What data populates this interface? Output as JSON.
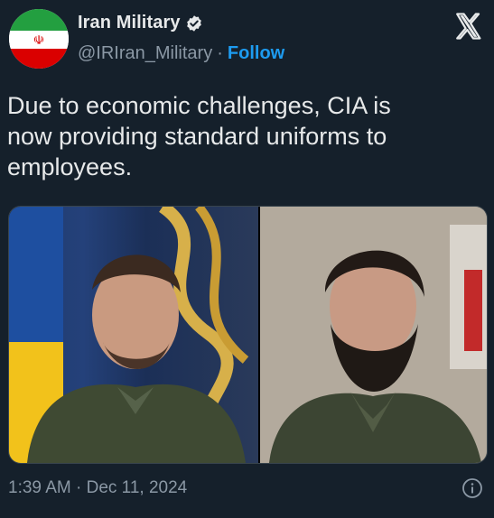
{
  "author": {
    "display_name": "Iran Military",
    "handle": "@IRIran_Military",
    "follow_label": "Follow",
    "separator": "·",
    "verified": true,
    "avatar_icon": "iran-flag-icon"
  },
  "tweet": {
    "text": "Due to economic challenges, CIA is\nnow providing standard uniforms to\nemployees.",
    "media": [
      {
        "kind": "photo",
        "description_icon": "photo-icon"
      },
      {
        "kind": "photo",
        "description_icon": "photo-icon"
      }
    ]
  },
  "footer": {
    "time": "1:39 AM",
    "separator": "·",
    "date": "Dec 11, 2024"
  },
  "colors": {
    "background": "#15202b",
    "text": "#e7e9ea",
    "muted": "#8b98a5",
    "accent": "#1d9bf0"
  }
}
